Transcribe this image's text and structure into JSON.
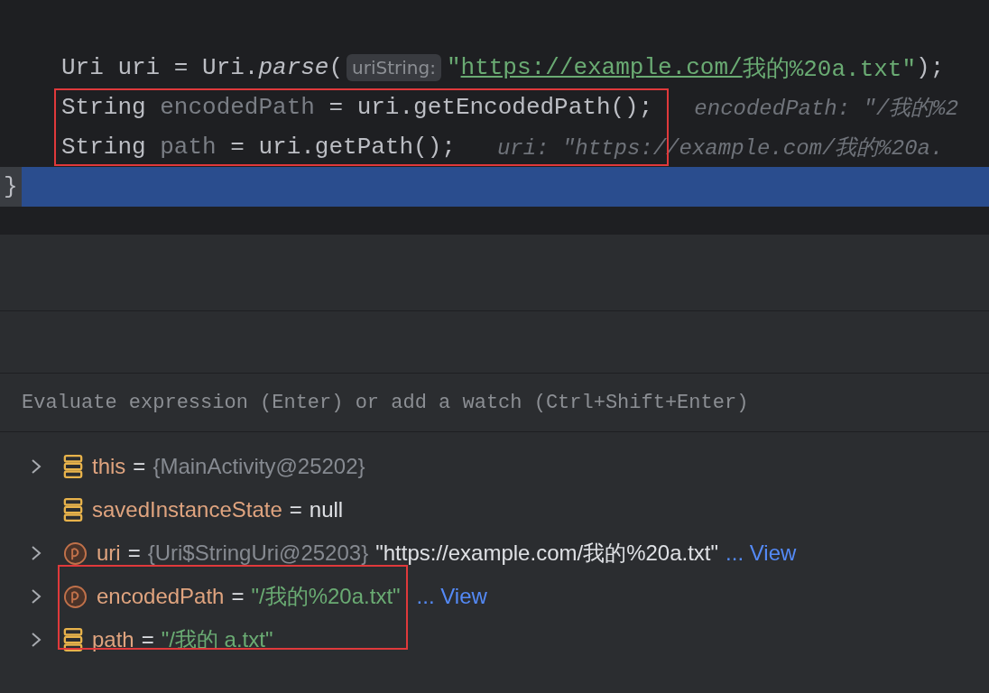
{
  "editor": {
    "lines": [
      {
        "kind": "statement",
        "current": false,
        "boxed": false,
        "tokens": [
          {
            "kind": "plain",
            "text": "Uri uri = Uri."
          },
          {
            "kind": "italic",
            "text": "parse"
          },
          {
            "kind": "plain",
            "text": "("
          },
          {
            "kind": "param",
            "text": "uriString:"
          },
          {
            "kind": "string",
            "text": "\""
          },
          {
            "kind": "link",
            "text": "https://example.com/"
          },
          {
            "kind": "string",
            "text": "我的%20a.txt\""
          },
          {
            "kind": "plain",
            "text": ");"
          }
        ]
      },
      {
        "kind": "statement",
        "current": false,
        "boxed": true,
        "tokens": [
          {
            "kind": "plain",
            "text": "String "
          },
          {
            "kind": "local",
            "text": "encodedPath"
          },
          {
            "kind": "plain",
            "text": " = uri.getEncodedPath();"
          },
          {
            "kind": "hint",
            "text": "encodedPath: \"/我的%2"
          }
        ]
      },
      {
        "kind": "statement",
        "current": false,
        "boxed": true,
        "tokens": [
          {
            "kind": "plain",
            "text": "String "
          },
          {
            "kind": "local",
            "text": "path"
          },
          {
            "kind": "plain",
            "text": " = uri.getPath();"
          },
          {
            "kind": "hint",
            "text": "uri: \"https://example.com/我的%20a."
          }
        ]
      },
      {
        "kind": "closing",
        "current": true,
        "boxed": false,
        "tokens": [
          {
            "kind": "brace",
            "text": "}"
          }
        ]
      }
    ]
  },
  "evaluate": {
    "placeholder": "Evaluate expression (Enter) or add a watch (Ctrl+Shift+Enter)"
  },
  "variables": [
    {
      "expandable": true,
      "kind": "field",
      "boxed": false,
      "name": "this",
      "operator": "=",
      "value": [
        {
          "kind": "ref",
          "text": "{MainActivity@25202}"
        }
      ]
    },
    {
      "expandable": false,
      "kind": "field",
      "boxed": false,
      "name": "savedInstanceState",
      "operator": "=",
      "value": [
        {
          "kind": "plain",
          "text": "null"
        }
      ]
    },
    {
      "expandable": true,
      "kind": "param",
      "boxed": false,
      "name": "uri",
      "operator": "=",
      "value": [
        {
          "kind": "ref",
          "text": "{Uri$StringUri@25203}"
        },
        {
          "kind": "plain",
          "text": "\"https://example.com/我的%20a.txt\""
        },
        {
          "kind": "link",
          "text": "... View"
        }
      ]
    },
    {
      "expandable": true,
      "kind": "param",
      "boxed": true,
      "name": "encodedPath",
      "operator": "=",
      "value": [
        {
          "kind": "string",
          "text": "\"/我的%20a.txt\""
        },
        {
          "kind": "link",
          "text": "... View"
        }
      ]
    },
    {
      "expandable": true,
      "kind": "field",
      "boxed": true,
      "name": "path",
      "operator": "=",
      "value": [
        {
          "kind": "string",
          "text": "\"/我的 a.txt\""
        }
      ]
    }
  ]
}
